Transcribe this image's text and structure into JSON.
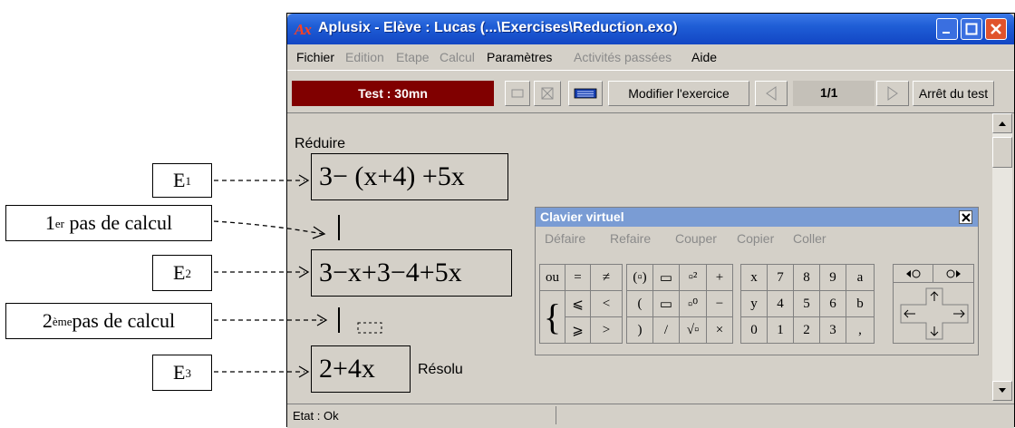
{
  "annotations": {
    "e1": {
      "base": "E",
      "sub": "1"
    },
    "pas1": {
      "sup": "er",
      "pre": "1",
      "text": " pas de calcul"
    },
    "e2": {
      "base": "E",
      "sub": "2"
    },
    "pas2": {
      "sup": "ème",
      "pre": "2",
      "text": "pas de calcul"
    },
    "e3": {
      "base": "E",
      "sub": "3"
    }
  },
  "window": {
    "logo": "Ax",
    "title": "Aplusix - Elève : Lucas  (...\\Exercises\\Reduction.exo)"
  },
  "menu": {
    "fichier": "Fichier",
    "edition": "Edition",
    "etape": "Etape",
    "calcul": "Calcul",
    "parametres": "Paramètres",
    "activites": "Activités passées",
    "aide": "Aide"
  },
  "toolbar": {
    "test_label": "Test : 30mn",
    "modifier": "Modifier l'exercice",
    "page": "1/1",
    "arret": "Arrêt du test"
  },
  "exercise": {
    "instruction": "Réduire",
    "e1": "3− (x+4) +5x",
    "e2": "3−x+3−4+5x",
    "e3": "2+4x",
    "resolu": "Résolu"
  },
  "status": {
    "text": "Etat : Ok"
  },
  "keyboard": {
    "title": "Clavier virtuel",
    "menu": [
      "Défaire",
      "Refaire",
      "Couper",
      "Copier",
      "Coller"
    ],
    "group1": [
      "ou",
      "=",
      "≠",
      "⩽",
      "<",
      "⩾",
      ">"
    ],
    "group2": [
      "(▫)",
      "▭",
      "▫²",
      "+",
      "(",
      "▭",
      "▫⁰",
      "−",
      ")",
      "/",
      "√▫",
      "×"
    ],
    "group3": [
      "x",
      "7",
      "8",
      "9",
      "a",
      "y",
      "4",
      "5",
      "6",
      "b",
      "0",
      "1",
      "2",
      "3",
      ","
    ]
  },
  "colors": {
    "title_bar": "#1f5ed6",
    "test_box": "#800000",
    "keyboard_title": "#7a9cd4"
  }
}
